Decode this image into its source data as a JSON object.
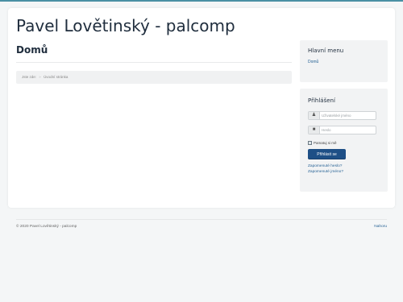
{
  "header": {
    "site_title": "Pavel Lovětinský - palcomp"
  },
  "main": {
    "page_title": "Domů",
    "breadcrumb": {
      "prefix": "Jste zde:",
      "separator": "»",
      "current": "Úvodní stránka"
    }
  },
  "sidebar": {
    "menu": {
      "title": "Hlavní menu",
      "items": [
        {
          "label": "Domů"
        }
      ]
    },
    "login": {
      "title": "Přihlášení",
      "username_placeholder": "Uživatelské jméno",
      "password_placeholder": "Heslo",
      "remember_label": "Pamatuj si mě",
      "remember_checked": true,
      "submit_label": "Přihlásit se",
      "forgot_password": "Zapomenuté heslo?",
      "forgot_username": "Zapomenuté jméno?"
    }
  },
  "footer": {
    "copyright": "© 2020 Pavel Lovětinský - palcomp",
    "back_to_top": "Nahoru"
  },
  "colors": {
    "accent": "#1e4f86",
    "link": "#2a6496",
    "page_bg": "#f4f6f7"
  }
}
